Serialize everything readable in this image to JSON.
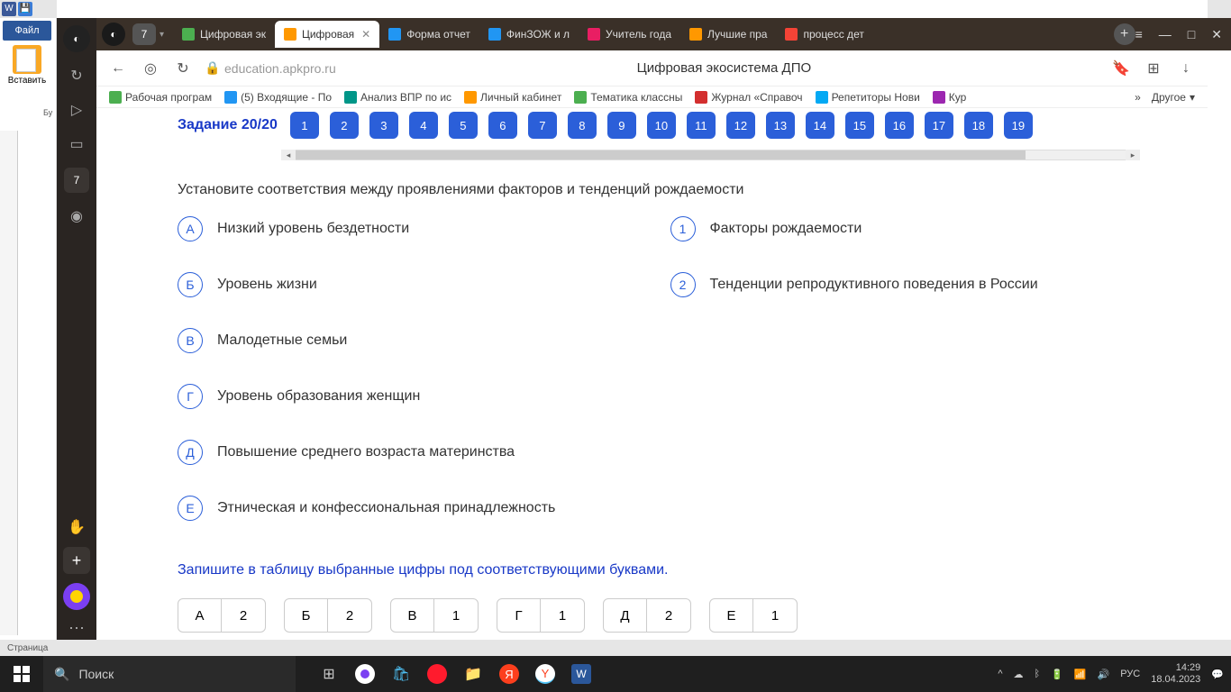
{
  "word": {
    "file_btn": "Файл",
    "paste": "Вставить",
    "buf": "Бу",
    "status": "Страница",
    "qat_w": "W"
  },
  "sidebar": {
    "tab_count": "7",
    "box_num": "7"
  },
  "tabs": [
    {
      "label": "Цифровая эк",
      "color": "#4caf50"
    },
    {
      "label": "Цифровая",
      "color": "#ff9800",
      "active": true
    },
    {
      "label": "Форма отчет",
      "color": "#2196f3"
    },
    {
      "label": "ФинЗОЖ и л",
      "color": "#2196f3"
    },
    {
      "label": "Учитель года",
      "color": "#e91e63"
    },
    {
      "label": "Лучшие пра",
      "color": "#ff9800"
    },
    {
      "label": "процесс дет",
      "color": "#f44336"
    }
  ],
  "window": {
    "min": "—",
    "max": "□",
    "close": "✕",
    "notif": "≡"
  },
  "address": {
    "url": "education.apkpro.ru",
    "title": "Цифровая экосистема ДПО"
  },
  "bookmarks": [
    {
      "label": "Рабочая програм",
      "color": "#4caf50"
    },
    {
      "label": "(5) Входящие - По",
      "color": "#2196f3"
    },
    {
      "label": "Анализ ВПР по ис",
      "color": "#009688"
    },
    {
      "label": "Личный кабинет",
      "color": "#ff9800"
    },
    {
      "label": "Тематика классны",
      "color": "#4caf50"
    },
    {
      "label": "Журнал «Справоч",
      "color": "#d32f2f"
    },
    {
      "label": "Репетиторы Нови",
      "color": "#03a9f4"
    },
    {
      "label": "Кур",
      "color": "#9c27b0"
    }
  ],
  "bm_other": "Другое",
  "task": {
    "title": "Задание 20/20",
    "numbers": [
      "1",
      "2",
      "3",
      "4",
      "5",
      "6",
      "7",
      "8",
      "9",
      "10",
      "11",
      "12",
      "13",
      "14",
      "15",
      "16",
      "17",
      "18",
      "19"
    ]
  },
  "question": "Установите соответствия между проявлениями факторов и тенденций рождаемости",
  "left_options": [
    {
      "letter": "А",
      "text": "Низкий уровень бездетности"
    },
    {
      "letter": "Б",
      "text": "Уровень жизни"
    },
    {
      "letter": "В",
      "text": "Малодетные семьи"
    },
    {
      "letter": "Г",
      "text": "Уровень образования женщин"
    },
    {
      "letter": "Д",
      "text": "Повышение среднего возраста материнства"
    },
    {
      "letter": "Е",
      "text": "Этническая и конфессиональная принадлежность"
    }
  ],
  "right_options": [
    {
      "num": "1",
      "text": "Факторы рождаемости"
    },
    {
      "num": "2",
      "text": "Тенденции репродуктивного поведения в России"
    }
  ],
  "instruction": "Запишите в таблицу выбранные цифры под соответствующими буквами.",
  "answers": [
    {
      "letter": "А",
      "value": "2"
    },
    {
      "letter": "Б",
      "value": "2"
    },
    {
      "letter": "В",
      "value": "1"
    },
    {
      "letter": "Г",
      "value": "1"
    },
    {
      "letter": "Д",
      "value": "2"
    },
    {
      "letter": "Е",
      "value": "1"
    }
  ],
  "taskbar": {
    "search": "Поиск",
    "lang": "РУС",
    "time": "14:29",
    "date": "18.04.2023"
  }
}
